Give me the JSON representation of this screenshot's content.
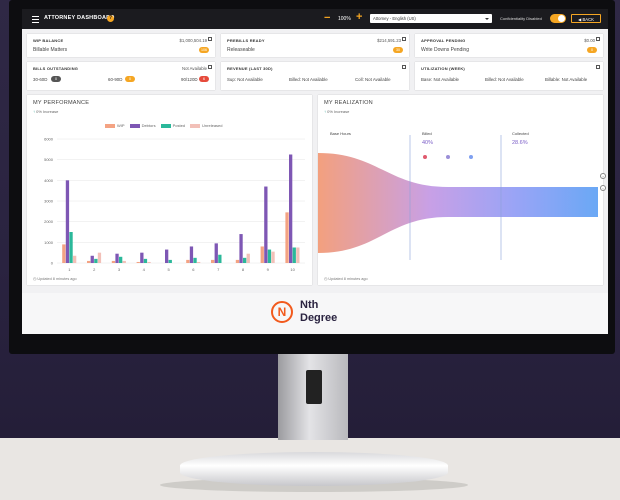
{
  "topbar": {
    "title": "ATTORNEY DASHBOARD",
    "help": "?",
    "minus": "−",
    "zoom": "100%",
    "plus": "+",
    "view_select": "Attorney - English (US)",
    "conflicts_label": "Confidentiality Disabled",
    "back_label": "◀ BACK"
  },
  "cards": {
    "wip": {
      "label": "WIP BALANCE",
      "sub": "Billable Matters",
      "amount": "$1,000,504.19",
      "badge": "106"
    },
    "prebills": {
      "label": "PREBILLS READY",
      "sub": "Releaseable",
      "amount": "$214,591.23",
      "badge": "30"
    },
    "approval": {
      "label": "APPROVAL PENDING",
      "sub": "Write Downs Pending",
      "amount": "$0.00",
      "badge": "0"
    },
    "bills": {
      "label": "BILLS OUTSTANDING",
      "status": "Not Available",
      "b1_label": "30-60D",
      "b1_val": "0",
      "b2_label": "60-90D",
      "b2_val": "0",
      "b3_label": "90/120D",
      "b3_val": "6"
    },
    "revenue": {
      "label": "REVENUE (LAST 30D)",
      "t1": "Sup: Not Available",
      "t2": "Billed: Not Available",
      "t3": "Coll: Not Available"
    },
    "utilization": {
      "label": "UTILIZATION (WEEK)",
      "t1": "Base: Not Available",
      "t2": "Billed: Not Available",
      "t3": "Billable: Not Available"
    }
  },
  "performance": {
    "title": "MY PERFORMANCE",
    "sub_pct": "0% Increase",
    "updated": "Updated 8 minutes ago"
  },
  "realization": {
    "title": "MY REALIZATION",
    "sub_pct": "0% Increase",
    "updated": "Updated 8 minutes ago",
    "col1": "Base Hours",
    "col2": "Billed",
    "col2_pct": "40%",
    "col3": "Collected",
    "col3_pct": "28.6%"
  },
  "brand": {
    "letter": "N",
    "line1": "Nth",
    "line2": "Degree"
  },
  "colors": {
    "wip": "#f4a383",
    "debtors": "#7e57b4",
    "posted": "#2bb89a",
    "unreleased": "#f2c0b8",
    "accent": "#f5a623"
  },
  "chart_data": {
    "type": "bar",
    "title": "",
    "categories": [
      "1",
      "2",
      "3",
      "4",
      "5",
      "6",
      "7",
      "8",
      "9",
      "10"
    ],
    "series": [
      {
        "name": "WIP",
        "values": [
          900,
          100,
          100,
          50,
          0,
          150,
          150,
          150,
          800,
          2450
        ]
      },
      {
        "name": "Debtors",
        "values": [
          4000,
          350,
          450,
          500,
          650,
          800,
          950,
          1400,
          3700,
          5250
        ]
      },
      {
        "name": "Posted",
        "values": [
          1500,
          200,
          300,
          200,
          150,
          250,
          400,
          250,
          650,
          750
        ]
      },
      {
        "name": "Unreleased",
        "values": [
          350,
          500,
          100,
          50,
          0,
          50,
          0,
          450,
          550,
          750
        ]
      }
    ],
    "ylim": [
      0,
      6000
    ],
    "yticks": [
      "0",
      "1000",
      "2000",
      "3000",
      "4000",
      "5000",
      "6000"
    ],
    "grid": true,
    "legend": "top"
  }
}
